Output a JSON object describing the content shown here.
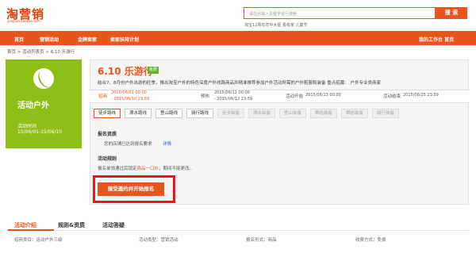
{
  "header": {
    "logo": "淘营销",
    "logo_sub": "yingxiao.taobao.com",
    "search_placeholder": "请在此输入关键字进行搜索",
    "search_button": "搜 索",
    "hot_words": "淘宝12周年年中大促 极有家 儿童节"
  },
  "nav": {
    "items": [
      "首页",
      "营销活动",
      "金牌卖家",
      "卖家扶持计划"
    ],
    "right": "我的工作台  首页"
  },
  "breadcrumb": "首页 > 活动列表页 > 6.10 乐游行",
  "hero": {
    "icon": "tennis-ball-icon",
    "title": "活动户外",
    "time_label": "活动时间",
    "time": "15/06/01-15/06/10",
    "color": "#8fbe16"
  },
  "activity": {
    "title": "6.10 乐游行",
    "tag": "免费",
    "desc": "结合7、8月份户外出游的旺季，推出淘宝户外的特色深度户外线路商品并精准推荐参加户外活动所需的户外鞋服和装备 重点招募： 户外专业类商家"
  },
  "stages": [
    {
      "label": "招商",
      "date1": "2015/06/01 00:00",
      "date2": "- 2015/06/10 23:59"
    },
    {
      "label": "预热",
      "date1": "2015/06/11 00:00",
      "date2": "- 2015/06/12 23:59"
    },
    {
      "label": "活动开始",
      "date1": "2015/06/13 00:00",
      "date2": ""
    },
    {
      "label": "活动结束",
      "date1": "2015/06/25 23:59",
      "date2": ""
    }
  ],
  "routes": [
    "徒步路线",
    "溯水路线",
    "登山路线",
    "骑行路线",
    "徒步装备",
    "溯水装备",
    "登山装备",
    "攀岩装备",
    "攀岩装备",
    "骑行装备"
  ],
  "qualification": {
    "title": "报名资质",
    "text": "您的店铺已达到报名要求",
    "link": "详情"
  },
  "rules": {
    "title": "活动规则",
    "text_before": "报名单领通过后锁定",
    "text_highlight": "商品一口价",
    "text_after": "，期间不能更改。"
  },
  "cta": "接受邀约并开始报名",
  "tabs": [
    "活动介绍",
    "规则&资质",
    "活动答疑"
  ],
  "info": [
    {
      "label": "招商类目：",
      "value": "运动户外三级"
    },
    {
      "label": "活动类型：",
      "value": "营销活动"
    },
    {
      "label": "报名形式：",
      "value": "商品"
    },
    {
      "label": "收费方式：",
      "value": "免费"
    }
  ],
  "colors": {
    "accent": "#e8541e",
    "hero": "#8fbe16",
    "highlight_frame": "#e8191d"
  }
}
